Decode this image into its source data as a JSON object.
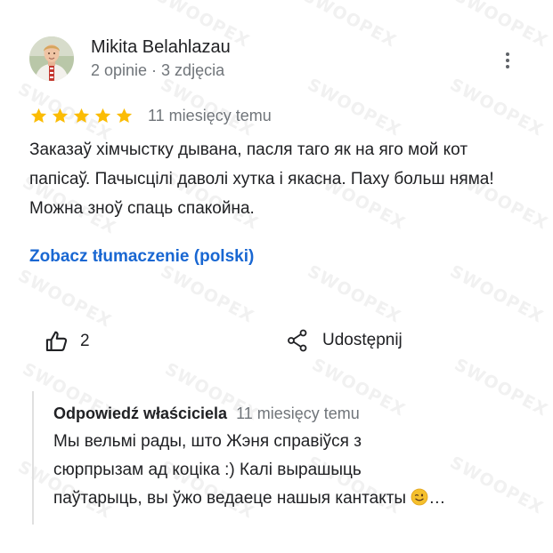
{
  "watermark": "SWOOPEX",
  "review": {
    "author": "Mikita Belahlazau",
    "meta": "2 opinie · 3 zdjęcia",
    "rating": 5,
    "time": "11 miesięcy temu",
    "text": "Заказаў хімчыстку дывана, пасля таго як на яго мой кот папісаў. Пачысцілі даволі хутка і якасна. Паху больш няма! Можна зноў спаць спакойна.",
    "translate_link": "Zobacz tłumaczenie (polski)",
    "likes": "2",
    "share_label": "Udostępnij"
  },
  "owner_reply": {
    "title": "Odpowiedź właściciela",
    "time": "11 miesięcy temu",
    "text_line1": "Мы вельмі рады, што Жэня справіўся з",
    "text_line2": "сюрпрызам ад коціка :) Калі вырашыць",
    "text_line3": "паўтарыць, вы ўжо ведаеце нашыя кантакты",
    "ellipsis": "…"
  },
  "colors": {
    "star": "#fbbc04",
    "link": "#1967d2",
    "secondary_text": "#70757a"
  },
  "icons": {
    "more": "more-vert-icon",
    "like": "thumb-up-icon",
    "share": "share-icon",
    "emoji": "winking-face-emoji"
  }
}
